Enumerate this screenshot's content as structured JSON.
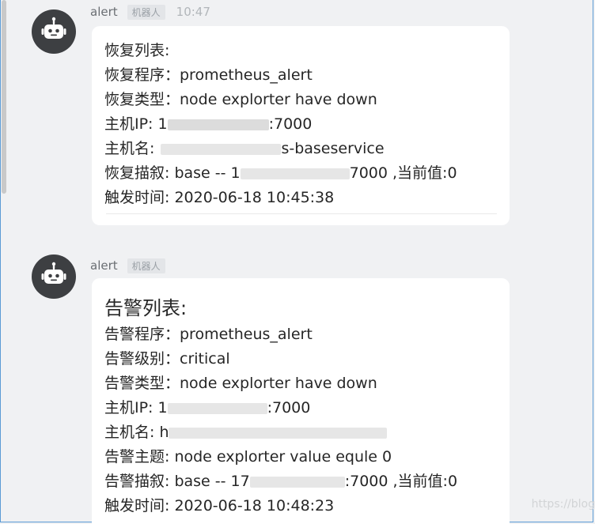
{
  "messages": [
    {
      "sender": "alert",
      "badge": "机器人",
      "time": "10:47",
      "title": "恢复列表:",
      "lines": {
        "program": "恢复程序：prometheus_alert",
        "type": "恢复类型：node explorter have down",
        "ip_prefix": "主机IP: 1",
        "ip_suffix": ":7000",
        "host_prefix": "主机名: ",
        "host_suffix": "s-baseservice",
        "desc_prefix": "恢复描叙: base -- 1",
        "desc_suffix": "7000 ,当前值:0",
        "time": "触发时间: 2020-06-18 10:45:38"
      }
    },
    {
      "sender": "alert",
      "badge": "机器人",
      "title": "告警列表:",
      "lines": {
        "program": "告警程序：prometheus_alert",
        "level": "告警级别：critical",
        "type": "告警类型：node explorter have down",
        "ip_prefix": "主机IP: 1",
        "ip_suffix": ":7000",
        "host_prefix": "主机名: h",
        "subject": "告警主题: node explorter value equle 0",
        "desc_prefix": "告警描叙: base -- 17",
        "desc_suffix": ":7000 ,当前值:0",
        "time": "触发时间: 2020-06-18 10:48:23"
      }
    }
  ],
  "watermark": "https://blog",
  "colors": {
    "avatar": "#3d3f42",
    "page_bg": "#f0f1f3",
    "bubble_bg": "#ffffff"
  }
}
